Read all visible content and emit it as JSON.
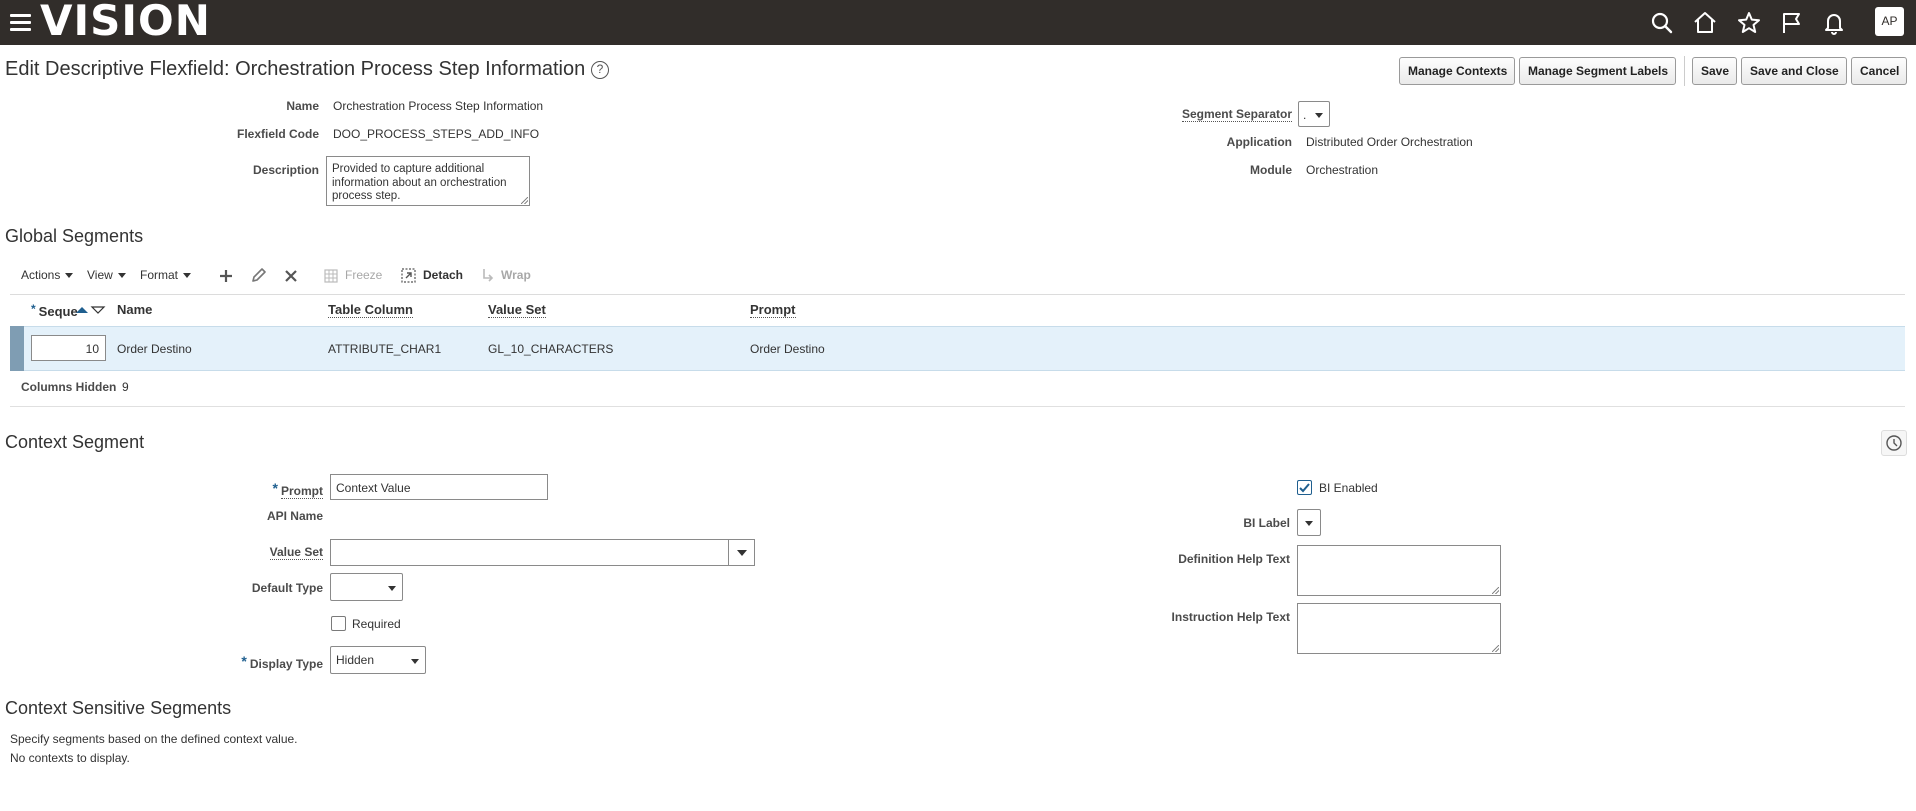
{
  "topbar": {
    "logo": "VISION",
    "avatar_initials": "AP",
    "icons": [
      "menu-icon",
      "search-icon",
      "home-icon",
      "star-icon",
      "flag-icon",
      "bell-icon"
    ]
  },
  "page": {
    "title": "Edit Descriptive Flexfield: Orchestration Process Step Information",
    "help": "?"
  },
  "buttons": {
    "manage_contexts": "Manage Contexts",
    "manage_segment_labels": "Manage Segment Labels",
    "save": "Save",
    "save_and_close": "Save and Close",
    "cancel": "Cancel"
  },
  "header_form": {
    "name_label": "Name",
    "name_value": "Orchestration Process Step Information",
    "code_label": "Flexfield Code",
    "code_value": "DOO_PROCESS_STEPS_ADD_INFO",
    "description_label": "Description",
    "description_value": "Provided to capture additional information about an orchestration process step.",
    "segment_separator_label": "Segment Separator",
    "segment_separator_value": ".",
    "application_label": "Application",
    "application_value": "Distributed Order Orchestration",
    "module_label": "Module",
    "module_value": "Orchestration"
  },
  "global_segments": {
    "title": "Global Segments",
    "toolbar": {
      "actions": "Actions",
      "view": "View",
      "format": "Format",
      "freeze": "Freeze",
      "detach": "Detach",
      "wrap": "Wrap"
    },
    "columns": {
      "sequence": "Seque",
      "name": "Name",
      "table_column": "Table Column",
      "value_set": "Value Set",
      "prompt": "Prompt"
    },
    "rows": [
      {
        "sequence": "10",
        "name": "Order Destino",
        "table_column": "ATTRIBUTE_CHAR1",
        "value_set": "GL_10_CHARACTERS",
        "prompt": "Order Destino"
      }
    ],
    "columns_hidden_label": "Columns Hidden",
    "columns_hidden_count": "9"
  },
  "context_segment": {
    "title": "Context Segment",
    "prompt_label": "Prompt",
    "prompt_value": "Context Value",
    "api_name_label": "API Name",
    "value_set_label": "Value Set",
    "value_set_value": "",
    "default_type_label": "Default Type",
    "default_type_value": "",
    "required_label": "Required",
    "required_checked": false,
    "display_type_label": "Display Type",
    "display_type_value": "Hidden",
    "bi_enabled_label": "BI Enabled",
    "bi_enabled_checked": true,
    "bi_label_label": "BI Label",
    "definition_help_label": "Definition Help Text",
    "instruction_help_label": "Instruction Help Text"
  },
  "context_sensitive": {
    "title": "Context Sensitive Segments",
    "line1": "Specify segments based on the defined context value.",
    "line2": "No contexts to display."
  },
  "colors": {
    "topbar_bg": "#312d2a",
    "selected_row": "#e4f1fa",
    "row_handle": "#7f9db3",
    "checkbox_check": "#1f5f8f"
  }
}
